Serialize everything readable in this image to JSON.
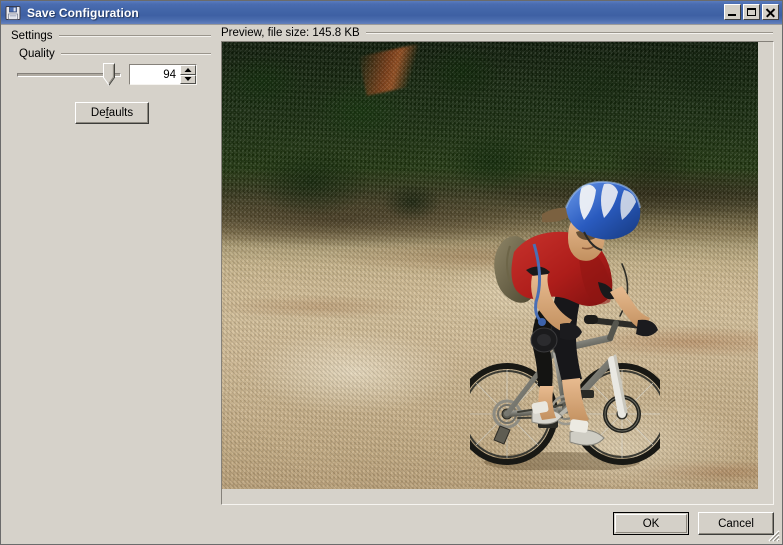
{
  "window": {
    "title": "Save Configuration",
    "icon": "save-floppy-icon",
    "controls": {
      "minimize": "minimize-icon",
      "maximize": "maximize-icon",
      "close": "close-icon"
    }
  },
  "settings_group": {
    "label": "Settings",
    "quality_group": {
      "label": "Quality",
      "slider": {
        "value": 94,
        "min": 0,
        "max": 100,
        "percent": 94
      },
      "spinner": {
        "value": "94",
        "placeholder": "0",
        "up_icon": "spin-up-arrow-icon",
        "down_icon": "spin-down-arrow-icon"
      }
    },
    "defaults_button": {
      "label_before": "De",
      "label_accel": "f",
      "label_after": "aults",
      "label_full": "Defaults"
    }
  },
  "preview_group": {
    "label": "Preview, file size: 145.8 KB",
    "file_size": "145.8 KB",
    "image": {
      "description": "Mountain biker in red jersey and blue-white helmet riding on a sandy dirt trail with dark green bushland behind",
      "alt": "Preview of saved image"
    },
    "vertical_scrollbar": {
      "up_icon": "scroll-up-arrow-icon",
      "down_icon": "scroll-down-arrow-icon",
      "thumb_position_percent": 0,
      "thumb_size_percent": 8
    },
    "horizontal_scrollbar": {
      "left_icon": "scroll-left-arrow-icon",
      "right_icon": "scroll-right-arrow-icon",
      "thumb_position_percent": 0,
      "thumb_size_percent": 72
    }
  },
  "footer": {
    "ok_button": "OK",
    "cancel_button": "Cancel",
    "resize_grip": "resize-grip-icon"
  },
  "colors": {
    "titlebar_blue": "#4366a9",
    "dialog_face": "#d6d2ca",
    "button_face": "#d4d0c8",
    "jersey_red": "#b5221f",
    "helmet_blue": "#2a5bbf",
    "sand_tan": "#d2bd94",
    "bush_green": "#1b300f"
  }
}
